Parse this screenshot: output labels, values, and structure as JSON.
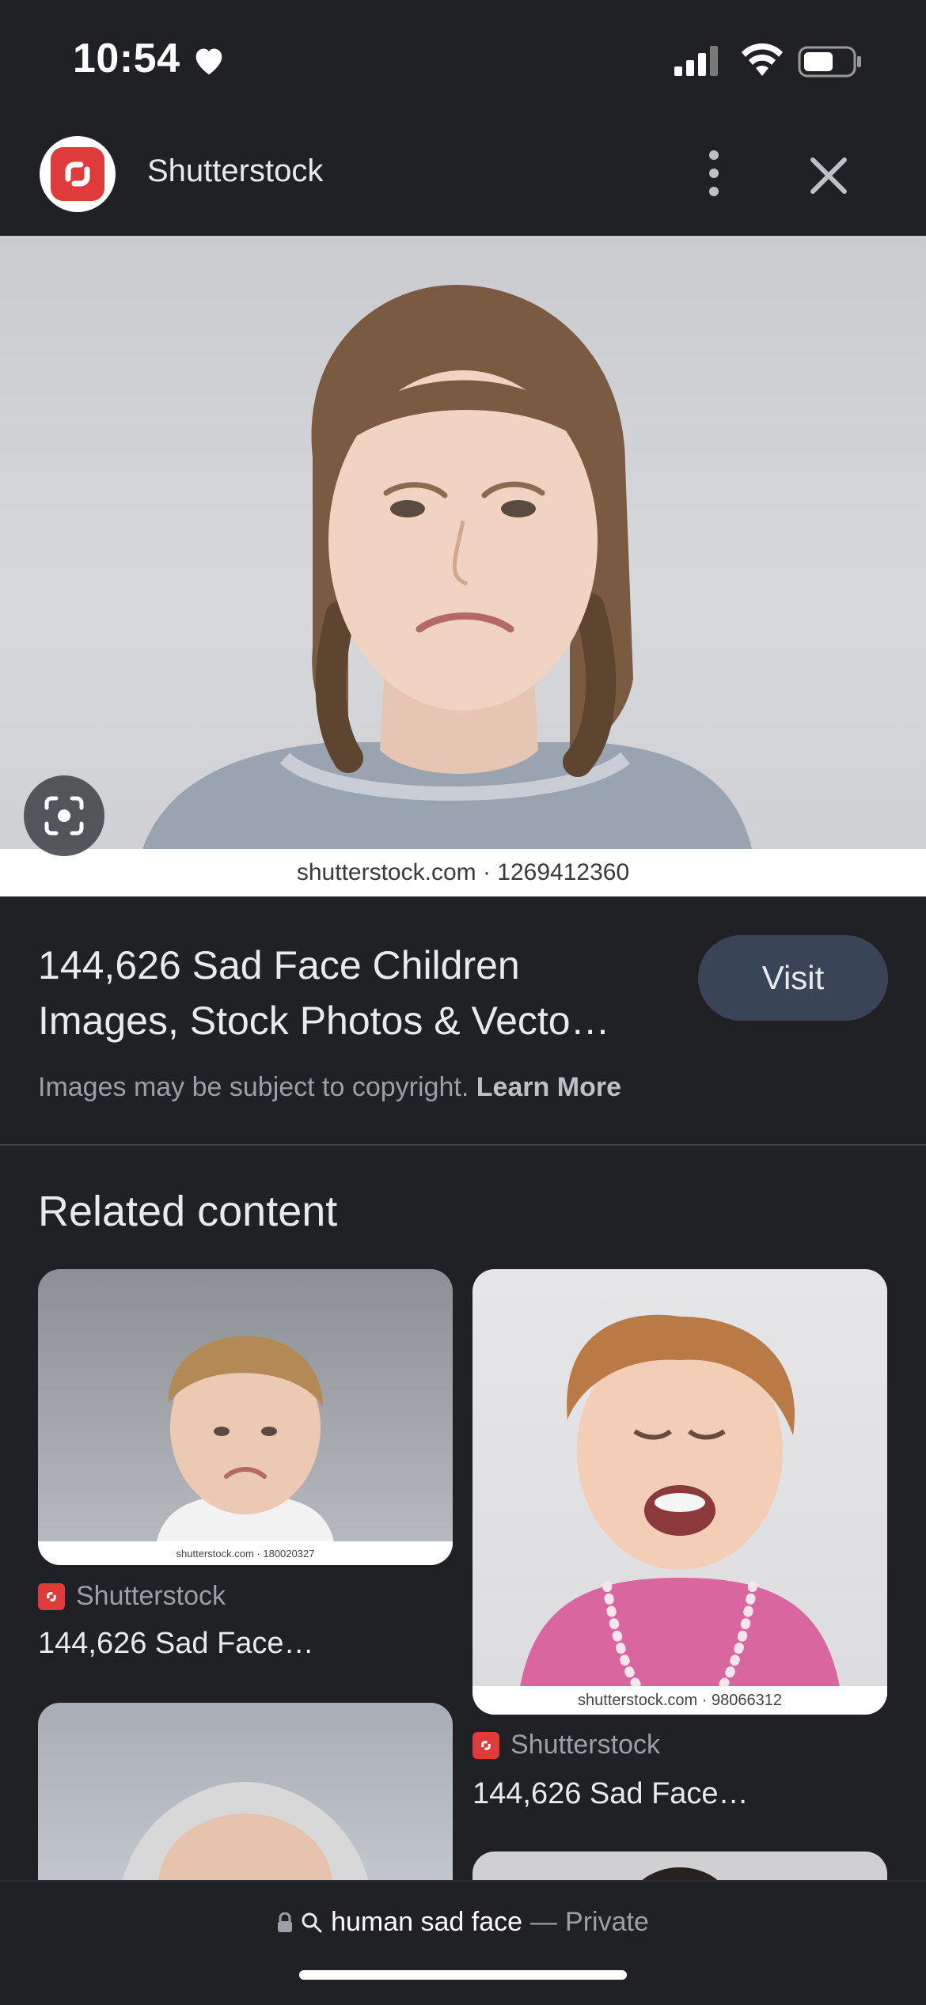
{
  "status_bar": {
    "time": "10:54"
  },
  "top_bar": {
    "site_name": "Shutterstock"
  },
  "hero": {
    "caption": "shutterstock.com · 1269412360"
  },
  "result": {
    "title": "144,626 Sad Face Children Images, Stock Photos & Vecto…",
    "visit_label": "Visit",
    "copyright_text": "Images may be subject to copyright.",
    "learn_more": "Learn More"
  },
  "related": {
    "heading": "Related content",
    "items": [
      {
        "caption": "shutterstock.com · 180020327",
        "source": "Shutterstock",
        "title": "144,626 Sad Face…"
      },
      {
        "caption": "shutterstock.com · 98066312",
        "source": "Shutterstock",
        "title": "144,626 Sad Face…"
      }
    ]
  },
  "bottom_bar": {
    "query": "human sad face",
    "separator": "—",
    "mode": "Private"
  },
  "colors": {
    "background": "#202124",
    "visit_button": "#394457",
    "brand": "#e03b3b"
  }
}
